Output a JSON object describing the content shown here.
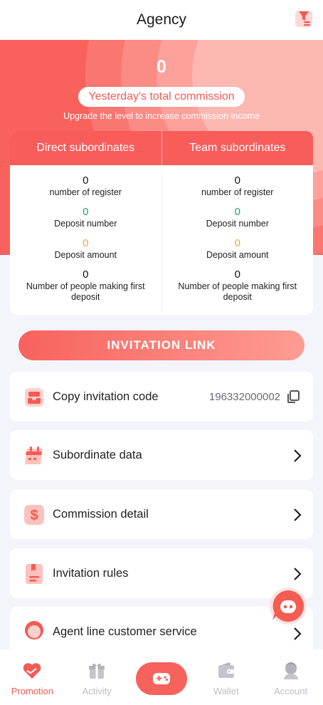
{
  "header": {
    "title": "Agency",
    "filter_icon": "filter-icon"
  },
  "hero": {
    "commission_value": "0",
    "commission_label": "Yesterday's total commission",
    "upgrade_hint": "Upgrade the level to increase commission income"
  },
  "stats": {
    "direct_title": "Direct subordinates",
    "team_title": "Team subordinates",
    "direct": {
      "register_value": "0",
      "register_label": "number of register",
      "deposit_number_value": "0",
      "deposit_number_label": "Deposit number",
      "deposit_amount_value": "0",
      "deposit_amount_label": "Deposit amount",
      "first_deposit_value": "0",
      "first_deposit_label": "Number of people making first deposit"
    },
    "team": {
      "register_value": "0",
      "register_label": "number of register",
      "deposit_number_value": "0",
      "deposit_number_label": "Deposit number",
      "deposit_amount_value": "0",
      "deposit_amount_label": "Deposit amount",
      "first_deposit_value": "0",
      "first_deposit_label": "Number of people making first deposit"
    }
  },
  "invitation_button": "INVITATION LINK",
  "menu": {
    "copy_code": {
      "label": "Copy invitation code",
      "value": "196332000002",
      "icon": "invitation-box-icon"
    },
    "subordinate_data": {
      "label": "Subordinate data",
      "icon": "calendar-icon"
    },
    "commission_detail": {
      "label": "Commission detail",
      "icon": "dollar-icon"
    },
    "invitation_rules": {
      "label": "Invitation rules",
      "icon": "rules-book-icon"
    },
    "customer_service": {
      "label": "Agent line customer service",
      "icon": "agent-avatar-icon"
    }
  },
  "bottom_nav": {
    "promotion": "Promotion",
    "activity": "Activity",
    "wallet": "Wallet",
    "account": "Account"
  },
  "colors": {
    "primary": "#f8625c",
    "deposit_number": "#23a35c",
    "deposit_amount": "#f7a44b",
    "nav_inactive": "#bcbcc6"
  }
}
